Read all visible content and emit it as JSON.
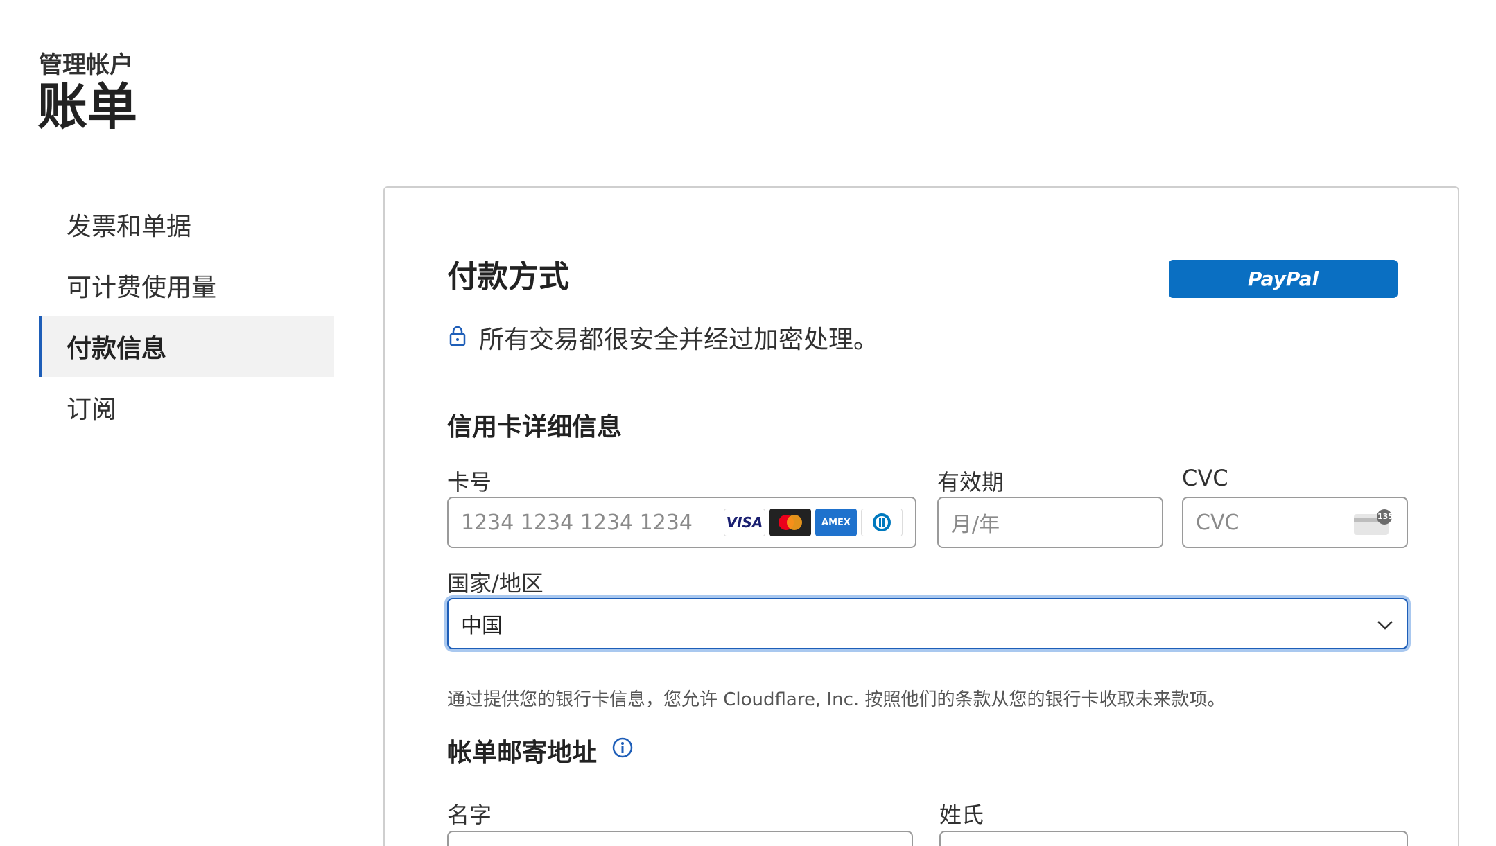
{
  "header": {
    "breadcrumb": "管理帐户",
    "title": "账单"
  },
  "sidebar": {
    "items": [
      {
        "label": "发票和单据"
      },
      {
        "label": "可计费使用量"
      },
      {
        "label": "付款信息"
      },
      {
        "label": "订阅"
      }
    ],
    "active": "付款信息"
  },
  "payment": {
    "title": "付款方式",
    "paypal_label": "PayPal",
    "secure_text": "所有交易都很安全并经过加密处理。",
    "card_section_title": "信用卡详细信息",
    "card_number_label": "卡号",
    "card_number_placeholder": "1234 1234 1234 1234",
    "card_brands": [
      "VISA",
      "Mastercard",
      "AMEX",
      "Diners"
    ],
    "expiry_label": "有效期",
    "expiry_placeholder": "月/年",
    "cvc_label": "CVC",
    "cvc_placeholder": "CVC",
    "cvc_icon_text": "135",
    "country_label": "国家/地区",
    "country_value": "中国",
    "authorization_notice": "通过提供您的银行卡信息，您允许 Cloudflare, Inc. 按照他们的条款从您的银行卡收取未来款项。",
    "billing_address_title": "帐单邮寄地址",
    "first_name_label": "名字",
    "last_name_label": "姓氏"
  },
  "colors": {
    "accent": "#1e5eb8",
    "paypal": "#0a6fc2",
    "focus_ring": "#a9c8ef"
  }
}
